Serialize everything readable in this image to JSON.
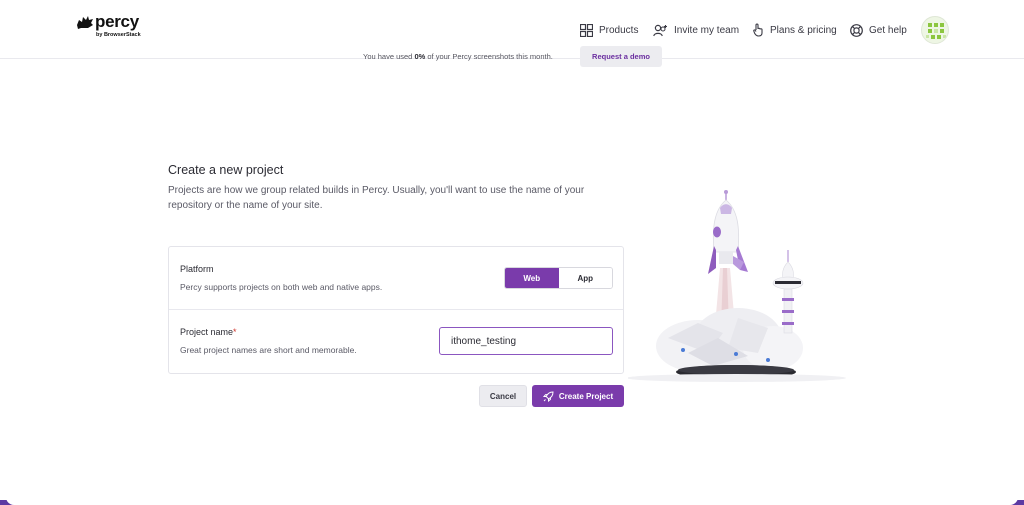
{
  "brand": {
    "name": "percy",
    "byline": "by BrowserStack"
  },
  "nav": {
    "products": "Products",
    "invite": "Invite my team",
    "plans": "Plans & pricing",
    "help": "Get help"
  },
  "banner": {
    "text_prefix": "You have used ",
    "used_percent": "0%",
    "text_suffix": " of your Percy screenshots this month.",
    "demo_button": "Request a demo"
  },
  "form": {
    "title": "Create a new project",
    "description": "Projects are how we group related builds in Percy. Usually, you'll want to use the name of your repository or the name of your site.",
    "platform": {
      "label": "Platform",
      "help": "Percy supports projects on both web and native apps.",
      "options": [
        "Web",
        "App"
      ],
      "selected": "Web"
    },
    "project_name": {
      "label": "Project name",
      "required_mark": "*",
      "help": "Great project names are short and memorable.",
      "value": "ithome_testing"
    },
    "cancel_button": "Cancel",
    "create_button": "Create Project"
  },
  "colors": {
    "accent": "#7a3bab",
    "link": "#6b2fa0",
    "required": "#d0342c"
  },
  "icons": {
    "products": "grid-icon",
    "invite": "add-user-icon",
    "plans": "hand-pointer-icon",
    "help": "lifebuoy-icon",
    "create": "rocket-icon"
  }
}
